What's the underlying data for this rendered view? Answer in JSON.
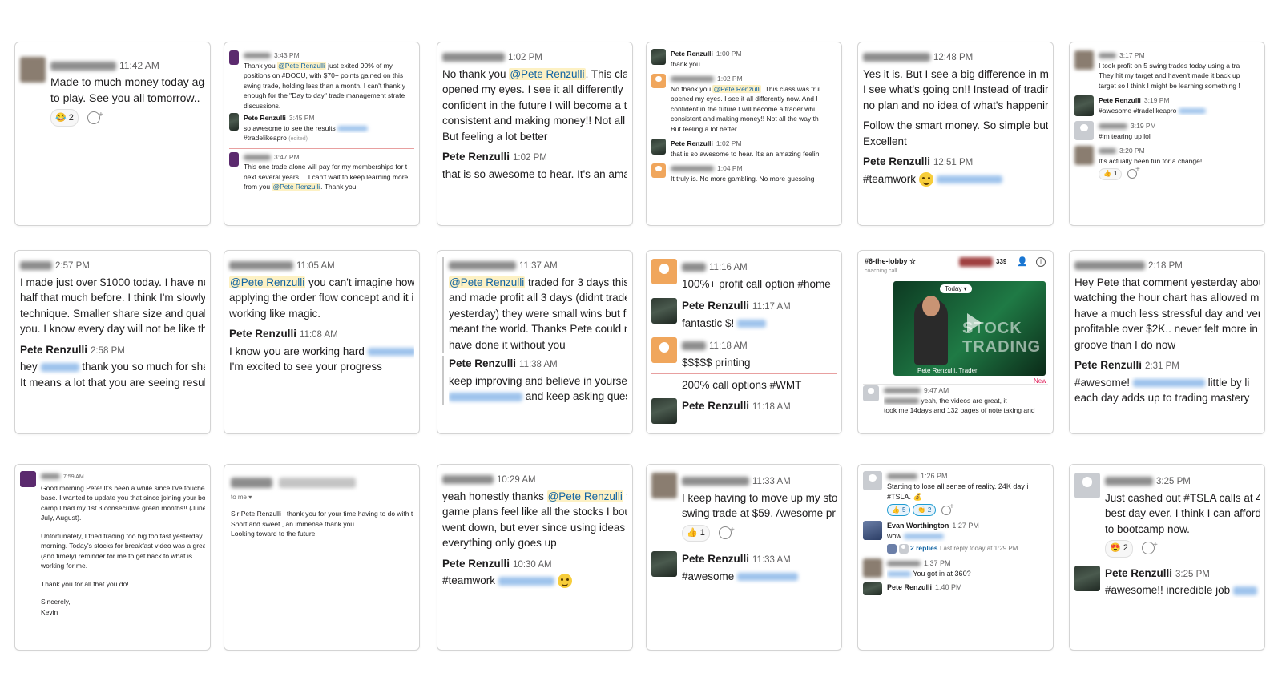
{
  "cards": {
    "c1": {
      "m1": {
        "time": "11:42 AM",
        "lines": [
          "Made to much money today agair",
          "to play. See you all tomorrow.."
        ],
        "react_count": "2"
      }
    },
    "c2": {
      "m1": {
        "time": "3:43 PM",
        "line1_pre": "Thank you ",
        "mention": "@Pete Renzulli",
        "line1_post": " just exited 90% of my",
        "lines": [
          "positions on #DOCU, with $70+ points gained on this",
          "swing trade, holding less than a month.  I can't thank y",
          "enough for the \"Day to day\" trade management strate",
          "discussions."
        ]
      },
      "m2": {
        "name": "Pete Renzulli",
        "time": "3:45 PM",
        "line1": "so awesome to see the results",
        "line2": "#tradelikeapro",
        "edited": "(edited)"
      },
      "m3": {
        "time": "3:47 PM",
        "lines": [
          "This one trade alone will pay for my memberships for t",
          "next several years.....I can't wait to keep learning more"
        ],
        "line3_pre": "from you ",
        "mention": "@Pete Renzulli",
        "line3_post": ". Thank you."
      }
    },
    "c3": {
      "m1": {
        "time": "1:02 PM",
        "line1_pre": "No thank you ",
        "mention": "@Pete Renzulli",
        "line1_post": ".  This clas:",
        "lines": [
          "opened my eyes. I see it all differently nc",
          "confident in the future I will become a tr",
          "consistent and making money!! Not all tl",
          "But feeling a lot better"
        ]
      },
      "m2": {
        "name": "Pete Renzulli",
        "time": "1:02 PM",
        "line1": "that is so awesome to hear. It's an amazi"
      }
    },
    "c4": {
      "m1": {
        "name": "Pete Renzulli",
        "time": "1:00 PM",
        "line1": "thank you"
      },
      "m2": {
        "time": "1:02 PM",
        "line1_pre": "No thank you ",
        "mention": "@Pete Renzulli",
        "line1_post": ".  This class was trul",
        "lines": [
          "opened my eyes. I see it all differently now. And I",
          "confident in the future I will become a trader whi",
          "consistent and making money!! Not all the way th",
          "But feeling a lot better"
        ]
      },
      "m3": {
        "name": "Pete Renzulli",
        "time": "1:02 PM",
        "line1": "that is so awesome to hear. It's an amazing feelin"
      },
      "m4": {
        "time": "1:04 PM",
        "line1": "It truly is.  No more gambling. No more guessing"
      }
    },
    "c5": {
      "m1": {
        "time": "12:48 PM",
        "lines": [
          "Yes it is. But I see a big difference in my",
          "I see what's going on!! Instead of trading",
          "no plan and no idea of what's happening"
        ],
        "lines2": [
          "Follow the smart money.  So simple but",
          "Excellent"
        ]
      },
      "m2": {
        "name": "Pete Renzulli",
        "time": "12:51 PM",
        "line1": "#teamwork"
      }
    },
    "c6": {
      "m1": {
        "time": "3:17 PM",
        "lines": [
          "I took profit on 5 swing trades today using a tra",
          "They hit my target and haven't made it back up",
          "target so I think I might be learning something !"
        ]
      },
      "m2": {
        "name": "Pete Renzulli",
        "time": "3:19 PM",
        "line1": "#awesome #tradelikeapro"
      },
      "m3": {
        "time": "3:19 PM",
        "line1": "#im tearing up lol"
      },
      "m4": {
        "time": "3:20 PM",
        "line1": "It's actually been fun for a change!",
        "react_count": "1"
      }
    },
    "c7": {
      "m1": {
        "time": "2:57 PM",
        "lines": [
          "I made just over $1000 today. I have ne",
          "half that much before. I think I'm slowly",
          "technique. Smaller share size and quality",
          "you. I know every day will not be like thi"
        ]
      },
      "m2": {
        "name": "Pete Renzulli",
        "time": "2:58 PM",
        "line1_pre": "hey ",
        "line1_post": " thank you so much for shar",
        "line2": "It means a lot that you are seeing results"
      }
    },
    "c8": {
      "m1": {
        "time": "11:05 AM",
        "mention": "@Pete Renzulli",
        "line1_post": " you can't imagine how I",
        "lines": [
          "applying the order flow concept and it i",
          "working like magic."
        ]
      },
      "m2": {
        "name": "Pete Renzulli",
        "time": "11:08 AM",
        "line1": "I know you are working hard",
        "line2": "I'm excited to see your progress"
      }
    },
    "c9": {
      "m1": {
        "time": "11:37 AM",
        "mention": "@Pete Renzulli",
        "line1_post": " traded for 3 days this v",
        "lines": [
          "and made profit all 3 days (didnt trade",
          "yesterday) they were small wins but fo",
          "meant the world. Thanks Pete could nc",
          "have done it without you"
        ]
      },
      "m2": {
        "name": "Pete Renzulli",
        "time": "11:38 AM",
        "line1": "keep improving and believe in yourself",
        "line2": " and keep asking ques"
      }
    },
    "c10": {
      "m1": {
        "time": "11:16 AM",
        "line1": "100%+ profit call option #home"
      },
      "m2": {
        "name": "Pete Renzulli",
        "time": "11:17 AM",
        "line1": "fantastic $!"
      },
      "m3": {
        "time": "11:18 AM",
        "line1": "$$$$$ printing"
      },
      "m4": {
        "line1": "200% call options #WMT"
      },
      "m5": {
        "name": "Pete Renzulli",
        "time": "11:18 AM"
      }
    },
    "c11": {
      "channel": "#6-the-lobby",
      "star": "☆",
      "sub": "coaching call",
      "members": "339",
      "today": "Today ▾",
      "video_title": "STOCK TRADING",
      "video_caption": "Pete Renzulli, Trader",
      "new_label": "New",
      "m1": {
        "time": "9:47 AM",
        "line1": "yeah, the videos are great,  it",
        "line2": "took me 14days and 132 pages of note taking and"
      }
    },
    "c12": {
      "m1": {
        "time": "2:18 PM",
        "lines": [
          "Hey Pete that comment yesterday abou",
          "watching the hour chart has allowed m",
          "have a much less stressful day and very",
          "profitable over $2K.. never felt more in",
          "groove than I do now"
        ]
      },
      "m2": {
        "name": "Pete Renzulli",
        "time": "2:31 PM",
        "line1": "#awesome!",
        "line1_post": " little by li",
        "line2": "each day adds up to trading mastery"
      }
    },
    "c13": {
      "m1": {
        "time": "7:59 AM",
        "lines": [
          "Good morning Pete! It's been a while since I've touched",
          "base. I wanted to update you that since joining your boot",
          "camp I had my 1st 3 consecutive green months!! (June,",
          "July, August)."
        ],
        "lines2": [
          "Unfortunately, I tried trading too big too fast yesterday",
          "morning.  Today's stocks for breakfast video was a great",
          "(and timely) reminder for me to get back to what is",
          "working for me."
        ],
        "line3": "Thank you for all that you do!",
        "sign1": "Sincerely,",
        "sign2": "Kevin"
      }
    },
    "c14": {
      "to": "to me ▾",
      "lines": [
        "Sir Pete Renzulli I thank you for your time having to do with the",
        "Short and sweet  , an immense thank you .",
        "Looking toward to the future"
      ]
    },
    "c15": {
      "m1": {
        "time": "10:29 AM",
        "line1_pre": "yeah honestly thanks ",
        "mention": "@Pete Renzulli",
        "line1_post": " fo",
        "lines": [
          "game plans feel like all the stocks I boug",
          "went down, but ever since using ideas ir",
          "everything only goes up"
        ]
      },
      "m2": {
        "name": "Pete Renzulli",
        "time": "10:30 AM",
        "line1": "#teamwork"
      }
    },
    "c16": {
      "m1": {
        "time": "11:33 AM",
        "lines": [
          "I keep having to move up my stop",
          "swing trade at $59.  Awesome pr"
        ],
        "react_count": "1"
      },
      "m2": {
        "name": "Pete Renzulli",
        "time": "11:33 AM",
        "line1": "#awesome"
      }
    },
    "c17": {
      "m1": {
        "time": "1:26 PM",
        "lines": [
          "Starting to lose all sense of reality.  24K day i",
          "#TSLA."
        ],
        "react1": "5",
        "react2": "2"
      },
      "m2": {
        "name": "Evan Worthington",
        "time": "1:27 PM",
        "line1": "wow",
        "replies": "2 replies",
        "last_reply": "Last reply today at 1:29 PM"
      },
      "m3": {
        "time": "1:37 PM",
        "line1": "You got in at 360?"
      },
      "m4": {
        "name": "Pete Renzulli",
        "time": "1:40 PM"
      }
    },
    "c18": {
      "m1": {
        "time": "3:25 PM",
        "lines": [
          "Just cashed out #TSLA calls at 45",
          "best day ever.  I think I can afford",
          "to bootcamp now."
        ],
        "react_count": "2"
      },
      "m2": {
        "name": "Pete Renzulli",
        "time": "3:25 PM",
        "line1": "#awesome!! incredible job"
      }
    }
  }
}
